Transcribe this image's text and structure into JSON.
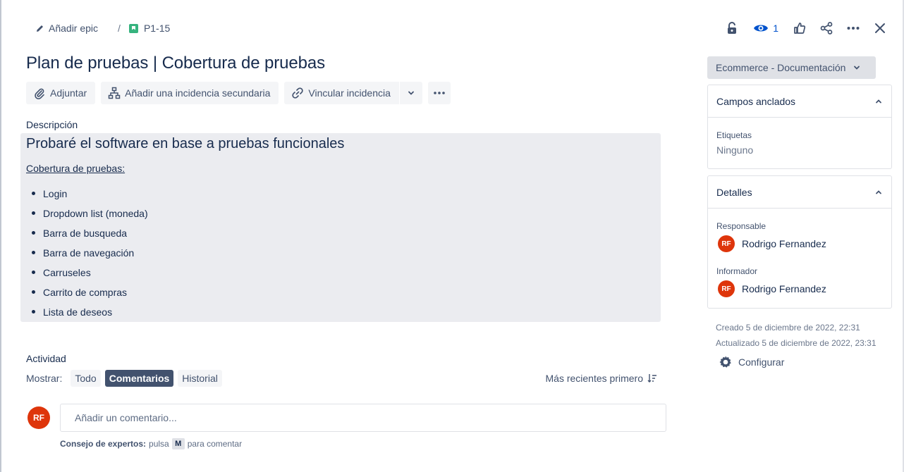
{
  "header": {
    "add_epic": "Añadir epic",
    "separator": "/",
    "issue_key": "P1-15",
    "watchers_count": "1"
  },
  "issue": {
    "title": "Plan de pruebas | Cobertura de pruebas"
  },
  "toolbar": {
    "attach": "Adjuntar",
    "add_child": "Añadir una incidencia secundaria",
    "link_issue": "Vincular incidencia"
  },
  "description": {
    "label": "Descripción",
    "heading": "Probaré el software en base a pruebas funcionales",
    "subheading": "Cobertura de pruebas:",
    "items": [
      "Login",
      "Dropdown list (moneda)",
      "Barra de busqueda",
      "Barra de navegación",
      "Carruseles",
      "Carrito de compras",
      "Lista de deseos"
    ]
  },
  "activity": {
    "label": "Actividad",
    "show_label": "Mostrar:",
    "filters": [
      "Todo",
      "Comentarios",
      "Historial"
    ],
    "active_filter": "Comentarios",
    "sort": "Más recientes primero",
    "comment_placeholder": "Añadir un comentario...",
    "user_initials": "RF",
    "tip_bold": "Consejo de expertos:",
    "tip_press": "pulsa",
    "tip_key": "M",
    "tip_rest": "para comentar"
  },
  "sidebar": {
    "status": "Ecommerce - Documentación",
    "pinned": {
      "title": "Campos anclados",
      "labels_label": "Etiquetas",
      "labels_value": "Ninguno"
    },
    "details": {
      "title": "Detalles",
      "assignee_label": "Responsable",
      "assignee": "Rodrigo Fernandez",
      "reporter_label": "Informador",
      "reporter": "Rodrigo Fernandez",
      "initials": "RF"
    },
    "created": "Creado 5 de diciembre de 2022, 22:31",
    "updated": "Actualizado 5 de diciembre de 2022, 23:31",
    "configure": "Configurar"
  },
  "colors": {
    "accent": "#0052cc",
    "avatar": "#de350b",
    "story": "#36b37e",
    "active_pill": "#42526e"
  }
}
